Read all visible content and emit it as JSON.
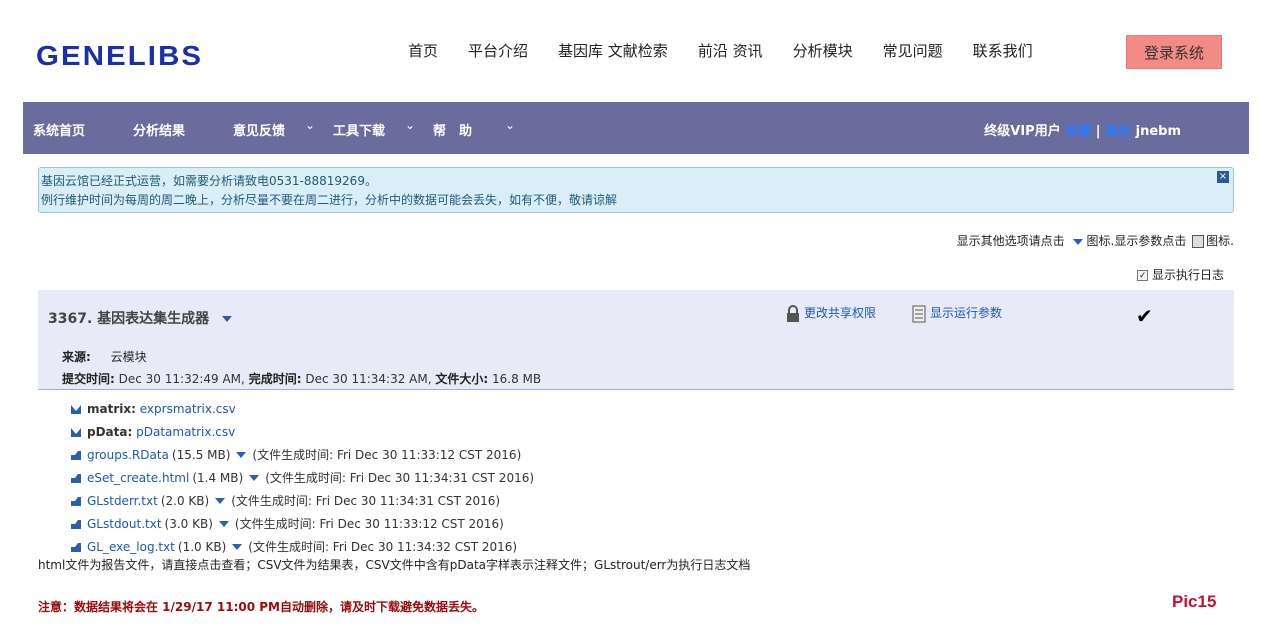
{
  "header": {
    "logo": "GENELIBS",
    "nav": [
      "首页",
      "平台介绍",
      "基因库  文献检索",
      "前沿 资讯",
      "分析模块",
      "常见问题",
      "联系我们"
    ],
    "login_label": "登录系统"
  },
  "menubar": {
    "items": [
      "系统首页",
      "分析结果",
      "意见反馈",
      "工具下载",
      "帮　助"
    ],
    "user_level": "终级VIP用户",
    "settings": "设置",
    "separator": "|",
    "logout": "退出",
    "username": "jnebm",
    "background_color": "#6b6c9e"
  },
  "notice": {
    "line1": "基因云馆已经正式运营，如需要分析请致电0531-88819269。",
    "line2": "例行维护时间为每周的周二晚上，分析尽量不要在周二进行，分析中的数据可能会丢失，如有不便，敬请谅解",
    "close": "×"
  },
  "options": {
    "part1": "显示其他选项请点击",
    "part2": "图标.显示参数点击",
    "part3": "图标.",
    "log_label": "显示执行日志",
    "log_checked": true
  },
  "task": {
    "title": "3367. 基因表达集生成器",
    "share_label": "更改共享权限",
    "params_label": "显示运行参数",
    "check": "✔",
    "source_label": "来源:",
    "source_value": "云模块",
    "submit_label": "提交时间:",
    "submit_value": "Dec 30 11:32:49 AM,",
    "finish_label": "完成时间:",
    "finish_value": "Dec 30 11:34:32 AM,",
    "size_label": "文件大小:",
    "size_value": "16.8 MB"
  },
  "inputs": [
    {
      "label": "matrix:",
      "file": "exprsmatrix.csv"
    },
    {
      "label": "pData:",
      "file": "pDatamatrix.csv"
    }
  ],
  "files": [
    {
      "name": "groups.RData",
      "size": "(15.5 MB)",
      "info": "(文件生成时间: Fri Dec 30 11:33:12 CST 2016)"
    },
    {
      "name": "eSet_create.html",
      "size": "(1.4 MB)",
      "info": "(文件生成时间: Fri Dec 30 11:34:31 CST 2016)"
    },
    {
      "name": "GLstderr.txt",
      "size": "(2.0 KB)",
      "info": "(文件生成时间: Fri Dec 30 11:34:31 CST 2016)"
    },
    {
      "name": "GLstdout.txt",
      "size": "(3.0 KB)",
      "info": "(文件生成时间: Fri Dec 30 11:33:12 CST 2016)"
    },
    {
      "name": "GL_exe_log.txt",
      "size": "(1.0 KB)",
      "info": "(文件生成时间: Fri Dec 30 11:34:32 CST 2016)"
    }
  ],
  "help_text": "html文件为报告文件，请直接点击查看；CSV文件为结果表，CSV文件中含有pData字样表示注释文件；GLstrout/err为执行日志文档",
  "warning": "注意：数据结果将会在 1/29/17 11:00 PM自动删除，请及时下载避免数据丢失。",
  "pic_label": "Pic15"
}
